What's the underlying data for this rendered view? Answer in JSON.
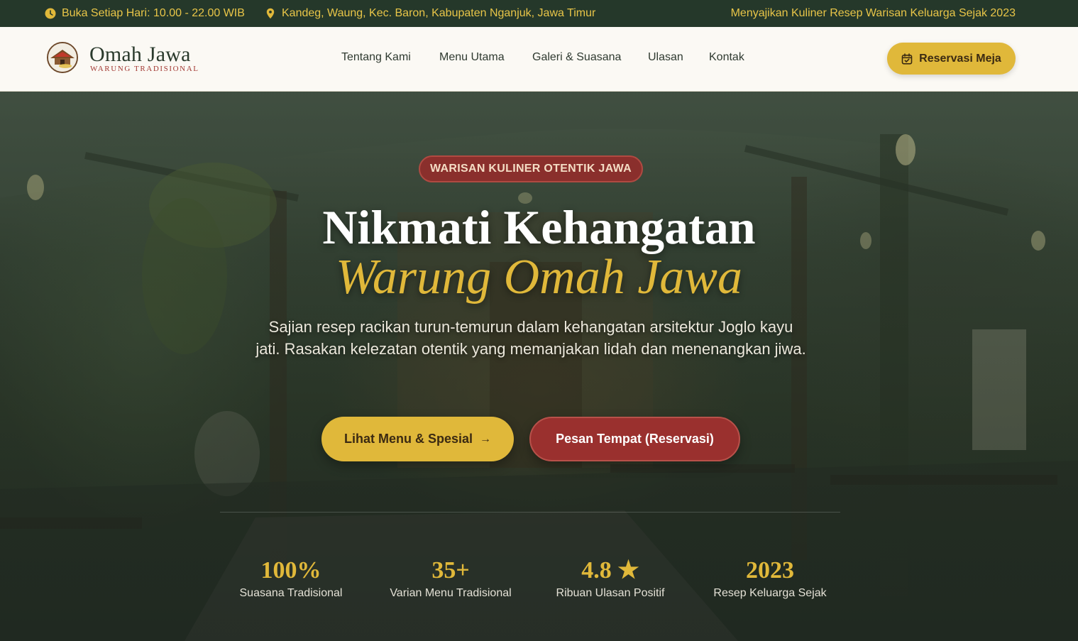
{
  "topbar": {
    "hours": "Buka Setiap Hari: 10.00 - 22.00 WIB",
    "address": "Kandeg, Waung, Kec. Baron, Kabupaten Nganjuk, Jawa Timur",
    "tagline": "Menyajikan Kuliner Resep Warisan Keluarga Sejak 2023",
    "hours_icon": "clock-icon",
    "address_icon": "map-pin-icon"
  },
  "nav": {
    "brand": "Omah Jawa",
    "brand_sub": "WARUNG TRADISIONAL",
    "links": [
      "Tentang Kami",
      "Menu Utama",
      "Galeri & Suasana",
      "Ulasan",
      "Kontak"
    ],
    "cta": "Reservasi Meja",
    "cta_icon": "calendar-check-icon"
  },
  "hero": {
    "badge": "WARISAN KULINER OTENTIK JAWA",
    "title_line1": "Nikmati Kehangatan",
    "title_line2": "Warung Omah Jawa",
    "description": "Sajian resep racikan turun-temurun dalam kehangatan arsitektur Joglo kayu jati. Rasakan kelezatan otentik yang memanjakan lidah dan menenangkan jiwa.",
    "primary_button": "Lihat Menu & Spesial",
    "primary_button_icon": "arrow-right-icon",
    "secondary_button": "Pesan Tempat (Reservasi)"
  },
  "stats": [
    {
      "value": "100%",
      "label": "Suasana Tradisional"
    },
    {
      "value": "35+",
      "label": "Varian Menu Tradisional"
    },
    {
      "value": "4.8 ★",
      "label": "Ribuan Ulasan Positif"
    },
    {
      "value": "2023",
      "label": "Resep Keluarga Sejak"
    }
  ],
  "colors": {
    "accent_gold": "#e0b83a",
    "accent_red": "#9a302e",
    "topbar_green": "#25382a"
  }
}
